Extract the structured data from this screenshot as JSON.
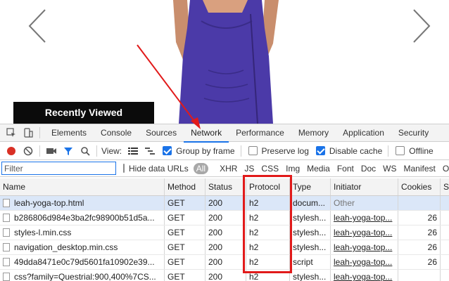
{
  "page": {
    "recently_viewed": "Recently Viewed",
    "dress_color": "#4b3aa8"
  },
  "devtools": {
    "tabs": [
      "Elements",
      "Console",
      "Sources",
      "Network",
      "Performance",
      "Memory",
      "Application",
      "Security"
    ],
    "active_tab": "Network",
    "toolbar": {
      "view_label": "View:",
      "group_by_frame": "Group by frame",
      "preserve_log": "Preserve log",
      "disable_cache": "Disable cache",
      "offline": "Offline",
      "group_by_frame_checked": true,
      "preserve_log_checked": false,
      "disable_cache_checked": true,
      "offline_checked": false
    },
    "filter": {
      "placeholder": "Filter",
      "hide_data_urls": "Hide data URLs",
      "types": [
        "All",
        "XHR",
        "JS",
        "CSS",
        "Img",
        "Media",
        "Font",
        "Doc",
        "WS",
        "Manifest",
        "Other"
      ]
    },
    "columns": [
      "Name",
      "Method",
      "Status",
      "Protocol",
      "Type",
      "Initiator",
      "Cookies",
      "S"
    ],
    "rows": [
      {
        "name": "leah-yoga-top.html",
        "method": "GET",
        "status": "200",
        "protocol": "h2",
        "type": "docum...",
        "initiator": "Other",
        "cookies": ""
      },
      {
        "name": "b286806d984e3ba2fc98900b51d5a...",
        "method": "GET",
        "status": "200",
        "protocol": "h2",
        "type": "stylesh...",
        "initiator": "leah-yoga-top...",
        "cookies": "26"
      },
      {
        "name": "styles-l.min.css",
        "method": "GET",
        "status": "200",
        "protocol": "h2",
        "type": "stylesh...",
        "initiator": "leah-yoga-top...",
        "cookies": "26"
      },
      {
        "name": "navigation_desktop.min.css",
        "method": "GET",
        "status": "200",
        "protocol": "h2",
        "type": "stylesh...",
        "initiator": "leah-yoga-top...",
        "cookies": "26"
      },
      {
        "name": "49dda8471e0c79d5601fa10902e39...",
        "method": "GET",
        "status": "200",
        "protocol": "h2",
        "type": "script",
        "initiator": "leah-yoga-top...",
        "cookies": "26"
      },
      {
        "name": "css?family=Questrial:900,400%7CS...",
        "method": "GET",
        "status": "200",
        "protocol": "h2",
        "type": "stylesh...",
        "initiator": "leah-yoga-top...",
        "cookies": ""
      }
    ],
    "accent_color": "#1a73e8",
    "highlight_color": "#e11a1a"
  }
}
